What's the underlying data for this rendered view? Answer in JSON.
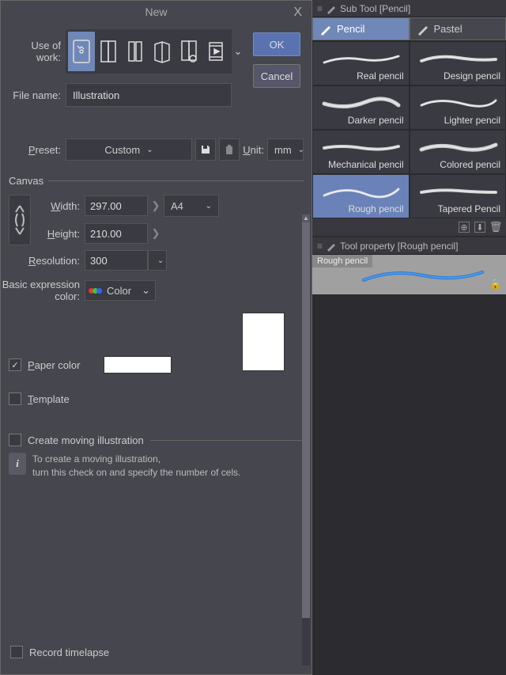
{
  "dialog": {
    "title": "New",
    "close": "X",
    "useOfWork": "Use of work:",
    "fileName": "File name:",
    "fileNameValue": "Illustration",
    "ok": "OK",
    "cancel": "Cancel",
    "presetLabel": "Preset:",
    "presetValue": "Custom",
    "unitLabel": "Unit:",
    "unitValue": "mm",
    "canvas": "Canvas",
    "widthLabel": "Width:",
    "widthValue": "297.00",
    "heightLabel": "Height:",
    "heightValue": "210.00",
    "sizePreset": "A4",
    "resolutionLabel": "Resolution:",
    "resolutionValue": "300",
    "expressionLabel": "Basic expression color:",
    "expressionValue": "Color",
    "paperColor": "Paper color",
    "template": "Template",
    "createMoving": "Create moving illustration",
    "infoLine1": "To create a moving illustration,",
    "infoLine2": "turn this check on and specify the number of cels.",
    "recordTimelapse": "Record timelapse"
  },
  "subTool": {
    "header": "Sub Tool [Pencil]",
    "tabs": [
      {
        "label": "Pencil",
        "active": true
      },
      {
        "label": "Pastel",
        "active": false
      }
    ],
    "brushes": [
      {
        "label": "Real pencil",
        "selected": false
      },
      {
        "label": "Design pencil",
        "selected": false
      },
      {
        "label": "Darker pencil",
        "selected": false
      },
      {
        "label": "Lighter pencil",
        "selected": false
      },
      {
        "label": "Mechanical pencil",
        "selected": false
      },
      {
        "label": "Colored pencil",
        "selected": false
      },
      {
        "label": "Rough pencil",
        "selected": true
      },
      {
        "label": "Tapered Pencil",
        "selected": false
      }
    ]
  },
  "toolProperty": {
    "header": "Tool property [Rough pencil]",
    "name": "Rough pencil"
  }
}
